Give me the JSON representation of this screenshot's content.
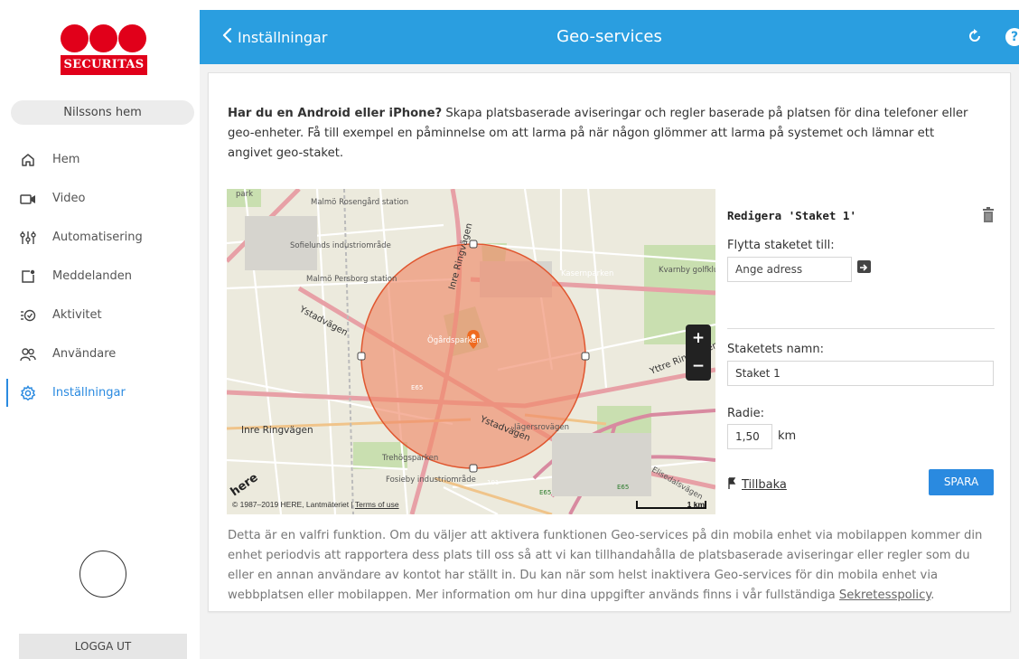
{
  "sidebar": {
    "brand": "SECURITAS",
    "home_name": "Nilssons hem",
    "items": [
      {
        "label": "Hem",
        "icon": "home-icon"
      },
      {
        "label": "Video",
        "icon": "video-icon"
      },
      {
        "label": "Automatisering",
        "icon": "sliders-icon"
      },
      {
        "label": "Meddelanden",
        "icon": "message-icon"
      },
      {
        "label": "Aktivitet",
        "icon": "activity-icon"
      },
      {
        "label": "Användare",
        "icon": "users-icon"
      },
      {
        "label": "Inställningar",
        "icon": "gear-icon",
        "active": true
      }
    ],
    "logout": "LOGGA UT"
  },
  "topbar": {
    "back_label": "Inställningar",
    "title": "Geo-services",
    "help": "?"
  },
  "intro": {
    "bold": "Har du en Android eller iPhone?",
    "text": " Skapa platsbaserade aviseringar och regler baserade på platsen för dina telefoner eller geo-enheter. Få till exempel en påminnelse om att larma på när någon glömmer att larma på systemet och lämnar ett angivet geo-staket."
  },
  "map": {
    "labels": [
      "park",
      "Malmö Rosengård station",
      "Sofielunds industriområde",
      "Malmö Persborg station",
      "Ystadvägen",
      "Inre Ringvägen",
      "Kvarnby golfklubb",
      "Kasernparken",
      "Ögårdsparken",
      "Yttre Ringvägen",
      "Jägersrovägen",
      "Ystadvägen",
      "Inre Ringvägen",
      "Trehögsparken",
      "Fosieby industriområde",
      "Elisedalsvägen",
      "E65",
      "E65",
      "E65",
      "101"
    ],
    "copyright": "© 1987–2019 HERE, Lantmäteriet | ",
    "terms": "Terms of use",
    "scale": "1 km",
    "here_logo": "here",
    "zoom_in": "+",
    "zoom_out": "−"
  },
  "panel": {
    "edit_title": "Redigera 'Staket 1'",
    "move_label": "Flytta staketet till:",
    "address_placeholder": "Ange adress",
    "name_label": "Staketets namn:",
    "name_value": "Staket 1",
    "radius_label": "Radie:",
    "radius_value": "1,50",
    "radius_unit": "km",
    "back_link": "Tillbaka",
    "save": "SPARA"
  },
  "footnote": {
    "text": "Detta är en valfri funktion. Om du väljer att aktivera funktionen Geo-services på din mobila enhet via mobilappen kommer din enhet periodvis att rapportera dess plats till oss så att vi kan tillhandahålla de platsbaserade aviseringar eller regler som du eller en annan användare av kontot har ställt in. Du kan när som helst inaktivera Geo-services för din mobila enhet via webbplatsen eller mobilappen. Mer information om hur dina uppgifter används finns i vår fullständiga ",
    "link": "Sekretesspolicy",
    "end": "."
  },
  "colors": {
    "topbar": "#2a9ee0",
    "accent": "#2a8ae0",
    "brand_red": "#e1001a",
    "fence_fill": "#f08a6a",
    "fence_stroke": "#e0562f"
  }
}
